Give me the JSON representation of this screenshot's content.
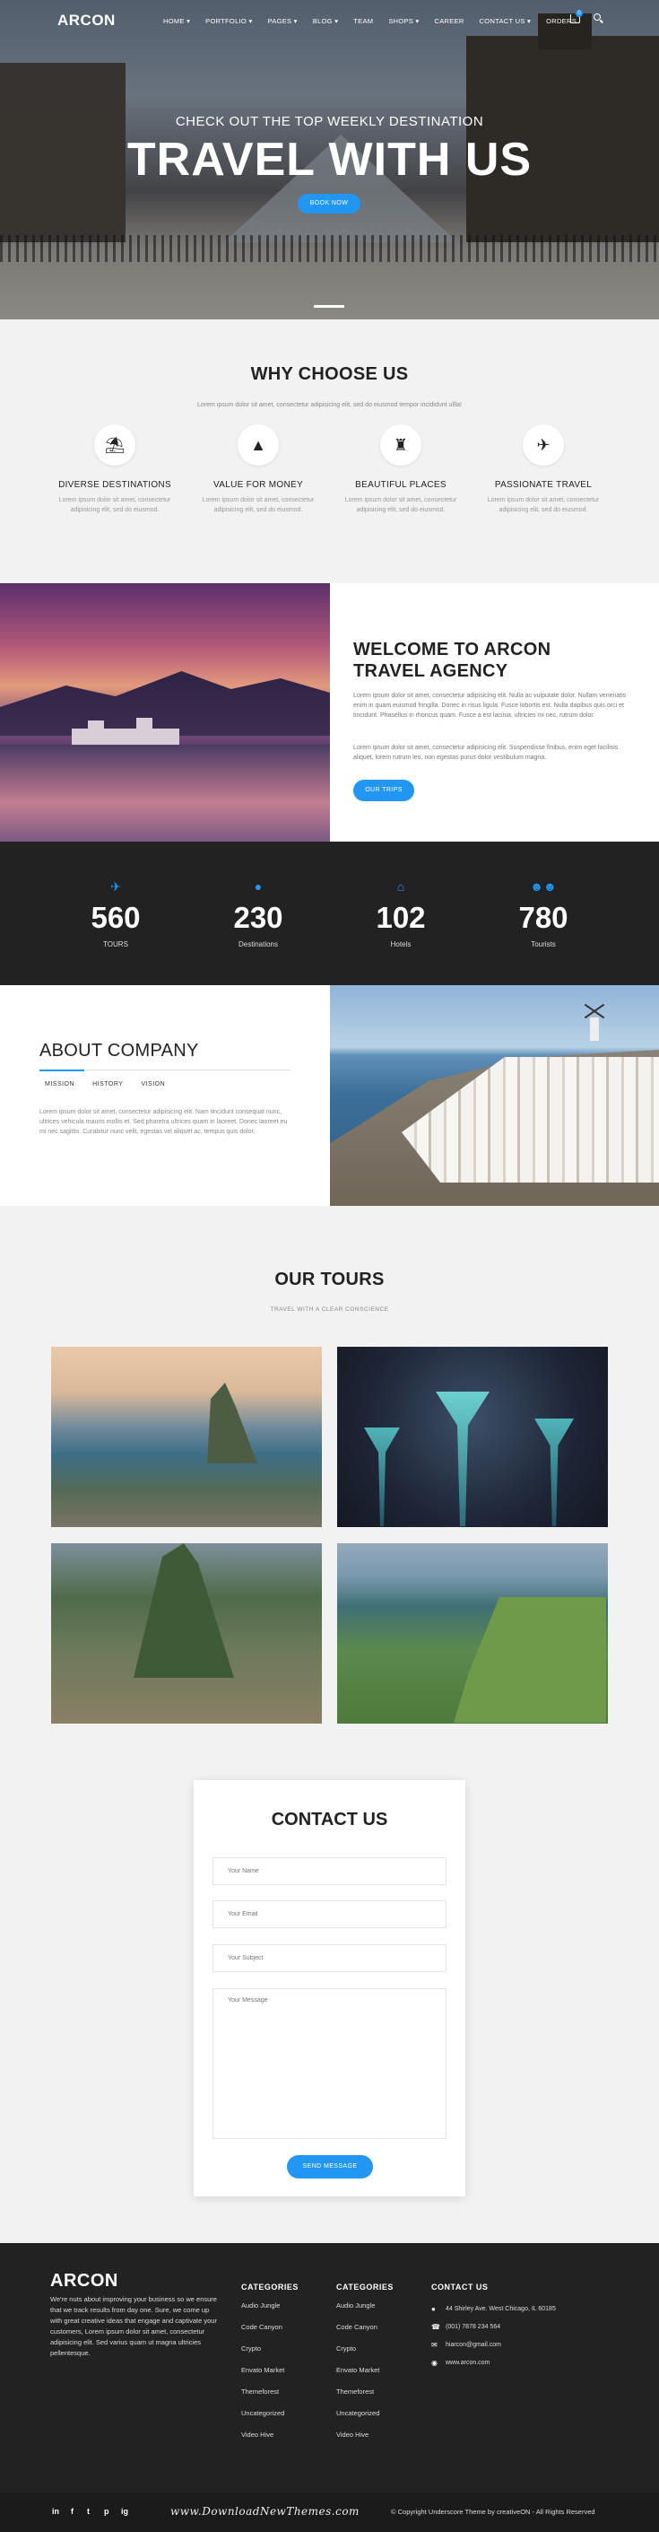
{
  "nav": {
    "logo": "ARCON",
    "menu": [
      "HOME ▾",
      "PORTFOLIO ▾",
      "PAGES ▾",
      "BLOG ▾",
      "TEAM",
      "SHOPS ▾",
      "CAREER",
      "CONTACT US ▾",
      "ORDERS"
    ],
    "cart_count": "0"
  },
  "hero": {
    "subtitle": "CHECK OUT THE TOP WEEKLY DESTINATION",
    "title": "TRAVEL WITH US",
    "button": "BOOK NOW"
  },
  "why": {
    "title": "WHY CHOOSE US",
    "subtitle": "Lorem ipsum dolor sit amet, consectetur adipisicing elit, sed do eiusmod tempor incididunt ullla!",
    "features": [
      {
        "icon": "umbrella-icon",
        "glyph": "⛱",
        "title": "DIVERSE DESTINATIONS",
        "desc": "Lorem ipsum dolor sit amet, consectetur adipisicing elit, sed do eiusmod."
      },
      {
        "icon": "mountain-icon",
        "glyph": "▲",
        "title": "VALUE FOR MONEY",
        "desc": "Lorem ipsum dolor sit amet, consectetur adipisicing elit, sed do eiusmod."
      },
      {
        "icon": "castle-icon",
        "glyph": "♜",
        "title": "BEAUTIFUL PLACES",
        "desc": "Lorem ipsum dolor sit amet, consectetur adipisicing elit, sed do eiusmod."
      },
      {
        "icon": "bird-icon",
        "glyph": "✈",
        "title": "PASSIONATE TRAVEL",
        "desc": "Lorem ipsum dolor sit amet, consectetur adipisicing elit, sed do eiusmod."
      }
    ]
  },
  "welcome": {
    "title_line1": "WELCOME TO ARCON",
    "title_line2": "TRAVEL AGENCY",
    "p1": "Lorem ipsum dolor sit amet, consectetur adipisicing elit. Nulla ac vulputate dolor. Nullam venenatis enim in quam euismod fringilla. Donec in risus ligula. Fusce lobortis est. Nulla dapibus quis orci et tincidunt. Phasellus in rhoncus quam. Fusce a est lacinia, ultricies mi nec, rutrum dolor.",
    "p2": "Lorem ipsum dolor sit amet, consectetur adipisicing elit. Suspendisse finibus, enim eget facilisis aliquet, lorem rutrum leo, non egestas purus dolor vestibulum magna.",
    "button": "OUR TRIPS"
  },
  "stats": [
    {
      "icon": "plane-icon",
      "glyph": "✈",
      "value": "560",
      "label": "TOURS"
    },
    {
      "icon": "map-pin-icon",
      "glyph": "●",
      "value": "230",
      "label": "Destinations"
    },
    {
      "icon": "home-icon",
      "glyph": "⌂",
      "value": "102",
      "label": "Hotels"
    },
    {
      "icon": "people-icon",
      "glyph": "☻☻",
      "value": "780",
      "label": "Tourists"
    }
  ],
  "about": {
    "title": "ABOUT COMPANY",
    "tabs": [
      "MISSION",
      "HISTORY",
      "VISION"
    ],
    "text": "Lorem ipsum dolor sit amet, consectetur adipisicing elit. Nam tincidunt consequat nunc, ultrices vehicula mauris mollis et. Sed pharetra ultrices quam in laoreet. Donec laoreet eu mi nec sagittis. Curabitur nunc velit, egestas vel aliquet ac, tempus quis dolor."
  },
  "tours": {
    "title": "OUR TOURS",
    "subtitle": "TRAVEL WITH A CLEAR CONSCIENCE"
  },
  "contact": {
    "title": "CONTACT US",
    "name_ph": "Your Name",
    "email_ph": "Your Email",
    "subject_ph": "Your Subject",
    "message_ph": "Your Message",
    "button": "SEND MESSAGE"
  },
  "footer": {
    "logo": "ARCON",
    "desc": "We're nuts about improving your business so we ensure that we track results from day one. Sure, we come up with great creative ideas that engage and captivate your customers, Lorem ipsum dolor sit amet, consectetur adipisicing elit. Sed varius quam ut magna ultricies pellentesque.",
    "col1_title": "CATEGORIES",
    "col1": [
      "Audio Jungle",
      "Code Canyon",
      "Crypto",
      "Envato Market",
      "Themeforest",
      "Uncategorized",
      "Video Hive"
    ],
    "col2_title": "CATEGORIES",
    "col2": [
      "Audio Jungle",
      "Code Canyon",
      "Crypto",
      "Envato Market",
      "Themeforest",
      "Uncategorized",
      "Video Hive"
    ],
    "contact_title": "CONTACT US",
    "address": "44 Shirley Ave. West Chicago, IL 60185",
    "phone": "(001) 7878 234 564",
    "email": "hiarcon@gmail.com",
    "web": "www.arcon.com"
  },
  "bottom": {
    "social": [
      "in",
      "f",
      "t",
      "p",
      "ig"
    ],
    "watermark": "www.DownloadNewThemes.com",
    "copyright": "© Copyright Underscore Theme by creativeON - All Rights Reserved"
  },
  "colors": {
    "accent": "#2196f3",
    "dark": "#222222",
    "light_bg": "#f2f2f2"
  }
}
